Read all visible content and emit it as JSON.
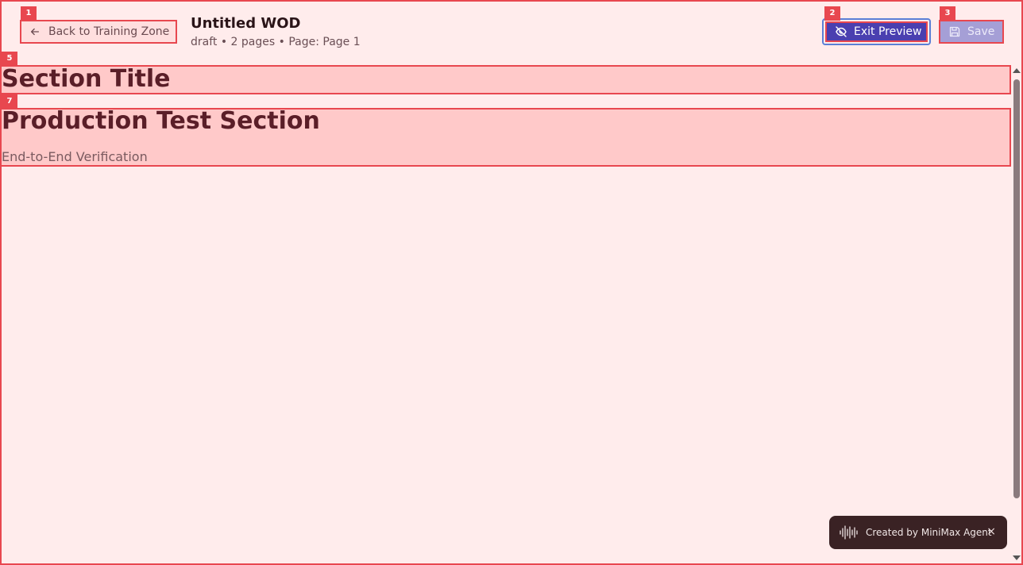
{
  "header": {
    "back_label": "Back to Training Zone",
    "title": "Untitled WOD",
    "subtitle": "draft • 2 pages • Page: Page 1",
    "exit_preview_label": "Exit Preview",
    "save_label": "Save"
  },
  "sections": [
    {
      "title": "Section Title"
    },
    {
      "title": "Production Test Section",
      "subtitle": "End-to-End Verification"
    }
  ],
  "badge": {
    "label": "Created by MiniMax Agent",
    "close": "×"
  },
  "markers": [
    "1",
    "2",
    "3",
    "5",
    "7"
  ],
  "icons": {
    "back": "arrow-left-icon",
    "exit": "eye-off-icon",
    "save": "floppy-disk-icon",
    "badge": "waveform-icon"
  }
}
